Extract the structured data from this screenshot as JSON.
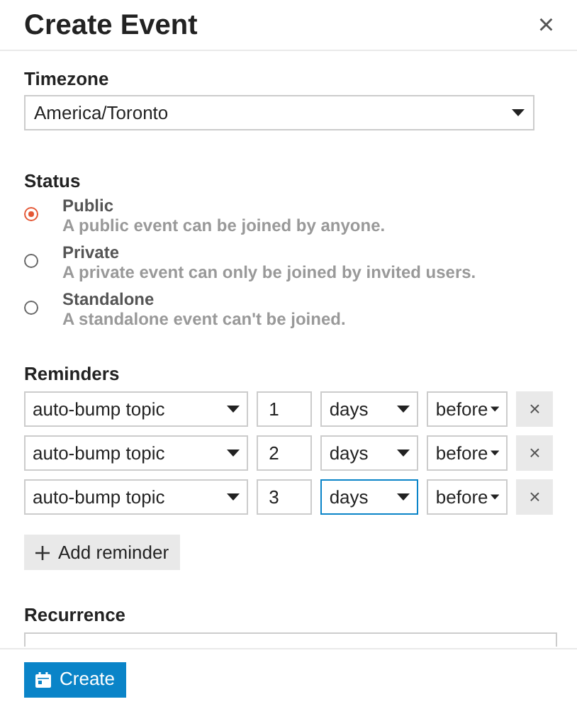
{
  "window": {
    "title": "Create Event",
    "close": "×"
  },
  "timezone": {
    "label": "Timezone",
    "value": "America/Toronto"
  },
  "status": {
    "label": "Status",
    "options": [
      {
        "label": "Public",
        "description": "A public event can be joined by anyone.",
        "selected": true
      },
      {
        "label": "Private",
        "description": "A private event can only be joined by invited users.",
        "selected": false
      },
      {
        "label": "Standalone",
        "description": "A standalone event can't be joined.",
        "selected": false
      }
    ]
  },
  "reminders": {
    "label": "Reminders",
    "rows": [
      {
        "type": "auto-bump topic",
        "value": "1",
        "unit": "days",
        "unit_focused": false,
        "position": "before",
        "remove": "×"
      },
      {
        "type": "auto-bump topic",
        "value": "2",
        "unit": "days",
        "unit_focused": false,
        "position": "before",
        "remove": "×"
      },
      {
        "type": "auto-bump topic",
        "value": "3",
        "unit": "days",
        "unit_focused": true,
        "position": "before",
        "remove": "×"
      }
    ],
    "add_button": "Add reminder"
  },
  "recurrence": {
    "label": "Recurrence"
  },
  "footer": {
    "create_button": "Create"
  }
}
